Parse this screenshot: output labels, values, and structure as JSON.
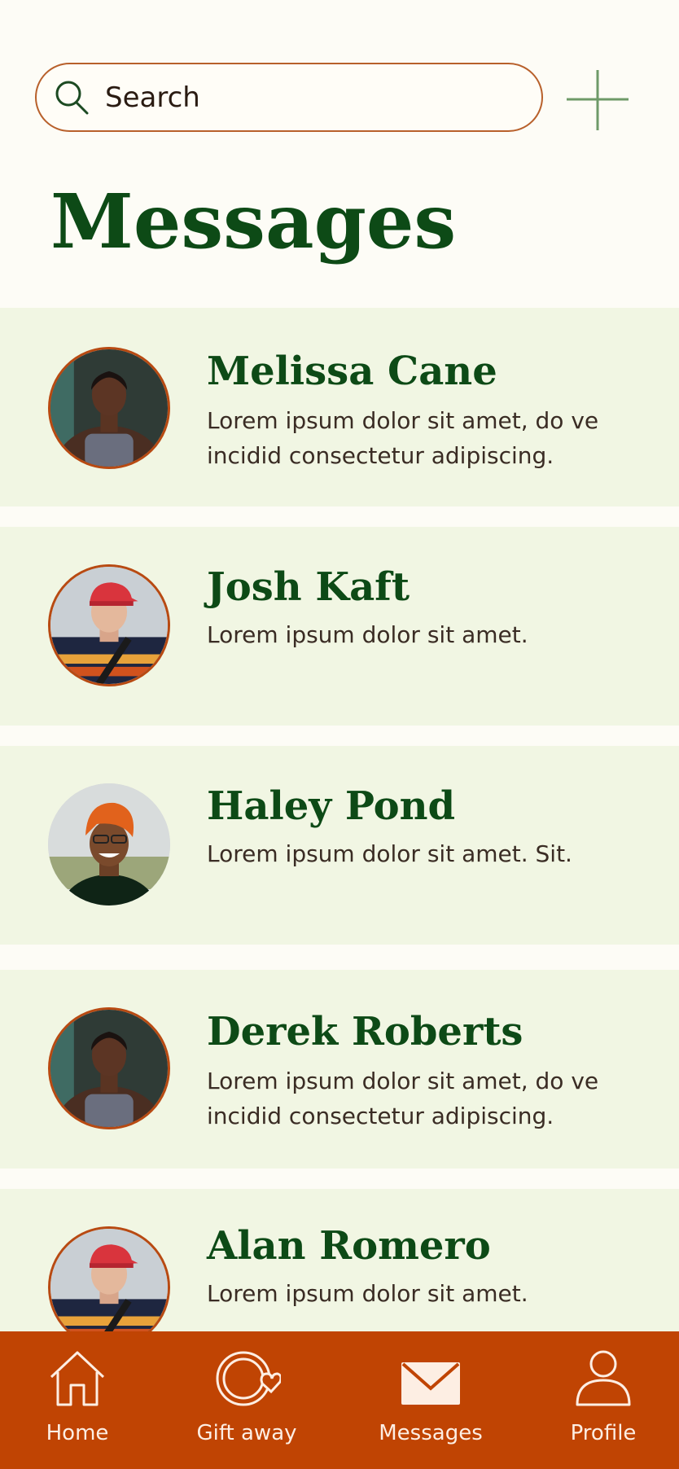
{
  "search": {
    "placeholder": "Search"
  },
  "header": {
    "title": "Messages"
  },
  "conversations": [
    {
      "name": "Melissa Cane",
      "preview": "Lorem ipsum dolor sit amet, do ve incidid consectetur adipiscing."
    },
    {
      "name": "Josh Kaft",
      "preview": "Lorem ipsum dolor sit amet."
    },
    {
      "name": "Haley Pond",
      "preview": "Lorem ipsum dolor sit amet. Sit."
    },
    {
      "name": "Derek Roberts",
      "preview": "Lorem ipsum dolor sit amet, do ve incidid consectetur adipiscing."
    },
    {
      "name": "Alan Romero",
      "preview": "Lorem ipsum dolor sit amet."
    }
  ],
  "tabbar": {
    "tabs": [
      {
        "label": "Home",
        "icon": "home-icon"
      },
      {
        "label": "Gift away",
        "icon": "gift-away-icon"
      },
      {
        "label": "Messages",
        "icon": "envelope-icon"
      },
      {
        "label": "Profile",
        "icon": "profile-icon"
      }
    ]
  },
  "colors": {
    "background": "#fdfcf6",
    "card": "#f1f6e3",
    "accent": "#c04403",
    "title_green": "#0d4a16"
  }
}
